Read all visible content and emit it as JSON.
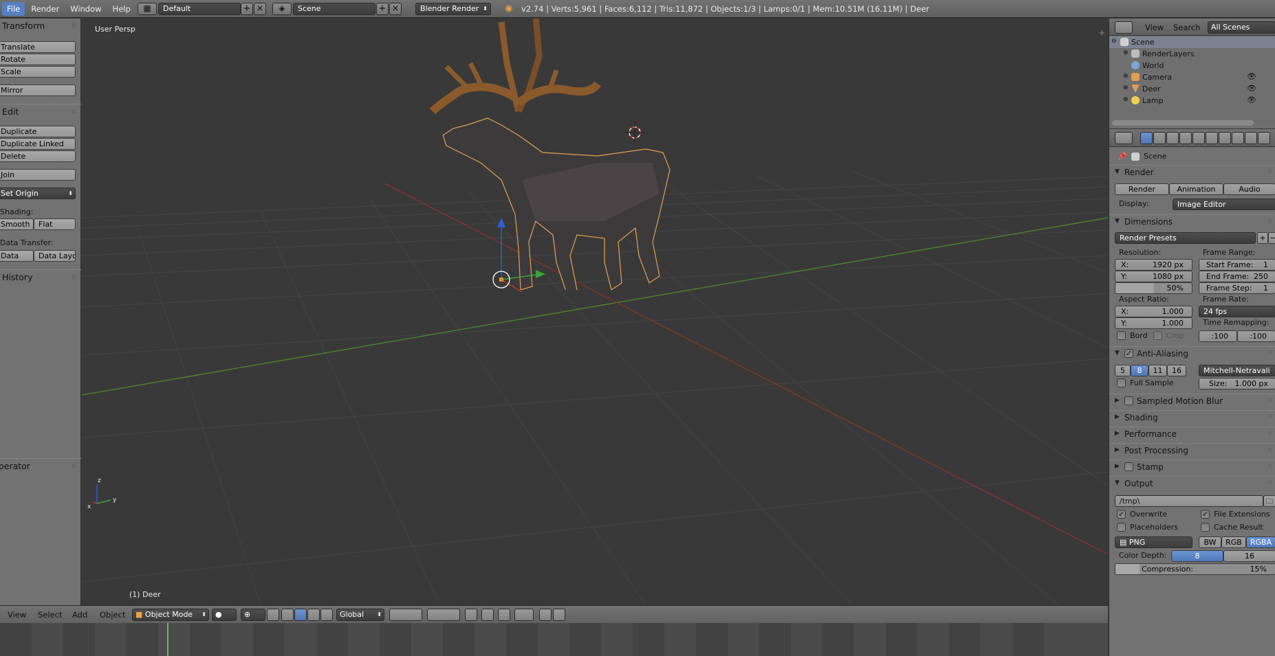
{
  "menubar": {
    "items": [
      {
        "label": "File",
        "active": true
      },
      {
        "label": "Render",
        "active": false
      },
      {
        "label": "Window",
        "active": false
      },
      {
        "label": "Help",
        "active": false
      }
    ],
    "screen_layout": "Default",
    "scene": "Scene",
    "render_engine": "Blender Render",
    "stats": "v2.74 | Verts:5,961 | Faces:6,112 | Tris:11,872 | Objects:1/3 | Lamps:0/1 | Mem:10.51M (16.11M) | Deer"
  },
  "toolshelf": {
    "transform_header": "Transform",
    "translate": "Translate",
    "rotate": "Rotate",
    "scale": "Scale",
    "mirror": "Mirror",
    "edit_header": "Edit",
    "duplicate": "Duplicate",
    "duplicate_linked": "Duplicate Linked",
    "delete": "Delete",
    "join": "Join",
    "set_origin": "Set Origin",
    "shading_label": "Shading:",
    "smooth": "Smooth",
    "flat": "Flat",
    "data_transfer_label": "Data Transfer:",
    "data": "Data",
    "data_layout": "Data Layo",
    "history_header": "History",
    "operator_header": "Operator"
  },
  "viewport": {
    "view_name": "User Persp",
    "active_object": "(1) Deer",
    "axis_labels": {
      "x": "x",
      "y": "y",
      "z": "z"
    }
  },
  "view_header": {
    "view": "View",
    "select": "Select",
    "add": "Add",
    "object": "Object",
    "mode": "Object Mode",
    "orientation": "Global"
  },
  "outliner": {
    "view": "View",
    "search": "Search",
    "filter": "All Scenes",
    "items": [
      {
        "label": "Scene",
        "icon": "scene-icon"
      },
      {
        "label": "RenderLayers",
        "icon": "render-layers-icon"
      },
      {
        "label": "World",
        "icon": "world-icon"
      },
      {
        "label": "Camera",
        "icon": "camera-icon"
      },
      {
        "label": "Deer",
        "icon": "mesh-icon"
      },
      {
        "label": "Lamp",
        "icon": "lamp-icon"
      }
    ]
  },
  "properties": {
    "context": "Scene",
    "render_panel": {
      "header": "Render",
      "render_btn": "Render",
      "animation_btn": "Animation",
      "audio_btn": "Audio",
      "display_label": "Display:",
      "display_value": "Image Editor"
    },
    "dimensions": {
      "header": "Dimensions",
      "presets": "Render Presets",
      "resolution_label": "Resolution:",
      "res_x_label": "X:",
      "res_x": "1920 px",
      "res_y_label": "Y:",
      "res_y": "1080 px",
      "res_pct": "50%",
      "frame_range_label": "Frame Range:",
      "start_label": "Start Frame:",
      "start": "1",
      "end_label": "End Frame:",
      "end": "250",
      "step_label": "Frame Step:",
      "step": "1",
      "aspect_label": "Aspect Ratio:",
      "aspect_x_label": "X:",
      "aspect_x": "1.000",
      "aspect_y_label": "Y:",
      "aspect_y": "1.000",
      "frame_rate_label": "Frame Rate:",
      "frame_rate": "24 fps",
      "time_remap_label": "Time Remapping:",
      "remap_old": ":100",
      "remap_new": ":100",
      "bord": "Bord",
      "crop": "Crop"
    },
    "anti_aliasing": {
      "header": "Anti-Aliasing",
      "samples": [
        "5",
        "8",
        "11",
        "16"
      ],
      "selected_sample": "8",
      "filter": "Mitchell-Netravali",
      "full_sample": "Full Sample",
      "size_label": "Size:",
      "size": "1.000 px"
    },
    "collapsed_panels": {
      "motion_blur": "Sampled Motion Blur",
      "shading": "Shading",
      "performance": "Performance",
      "post_processing": "Post Processing",
      "stamp": "Stamp"
    },
    "output": {
      "header": "Output",
      "path": "/tmp\\",
      "overwrite": "Overwrite",
      "file_extensions": "File Extensions",
      "placeholders": "Placeholders",
      "cache_result": "Cache Result",
      "format": "PNG",
      "bw": "BW",
      "rgb": "RGB",
      "rgba": "RGBA",
      "color_depth_label": "Color Depth:",
      "depth_8": "8",
      "depth_16": "16",
      "compression_label": "Compression:",
      "compression": "15%"
    }
  },
  "colors": {
    "accent": "#5680c2",
    "selection_outline": "#f09a3a"
  }
}
